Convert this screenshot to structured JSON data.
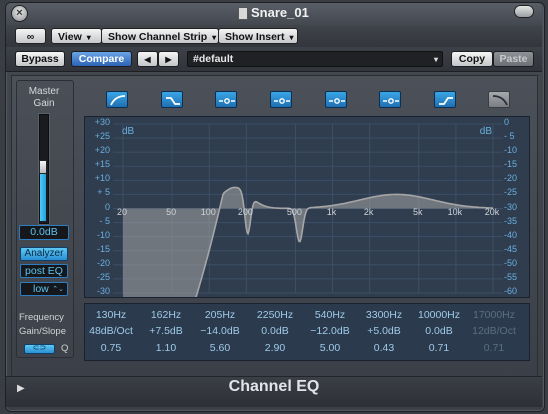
{
  "window": {
    "title": "Snare_01",
    "close_glyph": "×"
  },
  "toolbar": {
    "link_label": "∞",
    "view_label": "View",
    "channel_strip_label": "Show Channel Strip",
    "insert_label": "Show Insert",
    "dropdown_arrow": "▾"
  },
  "preset_bar": {
    "bypass_label": "Bypass",
    "compare_label": "Compare",
    "prev_label": "◀",
    "next_label": "▶",
    "preset_name": "#default",
    "copy_label": "Copy",
    "paste_label": "Paste"
  },
  "left": {
    "master_gain_label": "Master Gain",
    "master_gain_value": "0.0dB",
    "analyzer_label": "Analyzer",
    "post_eq_label": "post EQ",
    "resolution_label": "low",
    "resolution_arrow": "⌃⌄"
  },
  "bands": [
    {
      "icon": "high-pass-icon",
      "active": true
    },
    {
      "icon": "low-shelf-icon",
      "active": true
    },
    {
      "icon": "peak-icon",
      "active": true
    },
    {
      "icon": "peak-icon",
      "active": true
    },
    {
      "icon": "peak-icon",
      "active": true
    },
    {
      "icon": "peak-icon",
      "active": true
    },
    {
      "icon": "high-shelf-icon",
      "active": true
    },
    {
      "icon": "low-pass-icon",
      "active": false
    }
  ],
  "graph": {
    "db_label_left": "dB",
    "db_label_right": "dB",
    "left_axis": [
      "+30",
      "+25",
      "+20",
      "+15",
      "+10",
      "+ 5",
      "0",
      "- 5",
      "-10",
      "-15",
      "-20",
      "-25",
      "-30"
    ],
    "right_axis": [
      "0",
      "- 5",
      "-10",
      "-15",
      "-20",
      "-25",
      "-30",
      "-35",
      "-40",
      "-45",
      "-50",
      "-55",
      "-60"
    ],
    "freq_axis": [
      "20",
      "50",
      "100",
      "200",
      "500",
      "1k",
      "2k",
      "5k",
      "10k",
      "20k"
    ]
  },
  "params": {
    "row_labels": {
      "frequency": "Frequency",
      "gain_slope": "Gain/Slope",
      "q": "Q",
      "link_label": "⊂⊃"
    },
    "frequency": [
      "130Hz",
      "162Hz",
      "205Hz",
      "2250Hz",
      "540Hz",
      "3300Hz",
      "10000Hz",
      "17000Hz"
    ],
    "gain": [
      "48dB/Oct",
      "+7.5dB",
      "−14.0dB",
      "0.0dB",
      "−12.0dB",
      "+5.0dB",
      "0.0dB",
      "12dB/Oct"
    ],
    "q": [
      "0.75",
      "1.10",
      "5.60",
      "2.90",
      "5.00",
      "0.43",
      "0.71",
      "0.71"
    ],
    "active": [
      true,
      true,
      true,
      true,
      true,
      true,
      true,
      false
    ]
  },
  "footer": {
    "plugin_name": "Channel EQ",
    "disclosure": "▶"
  },
  "colors": {
    "accent": "#2f9ae0",
    "curve": "#a6a6a6",
    "graph_bg": "#2f3d4f"
  }
}
